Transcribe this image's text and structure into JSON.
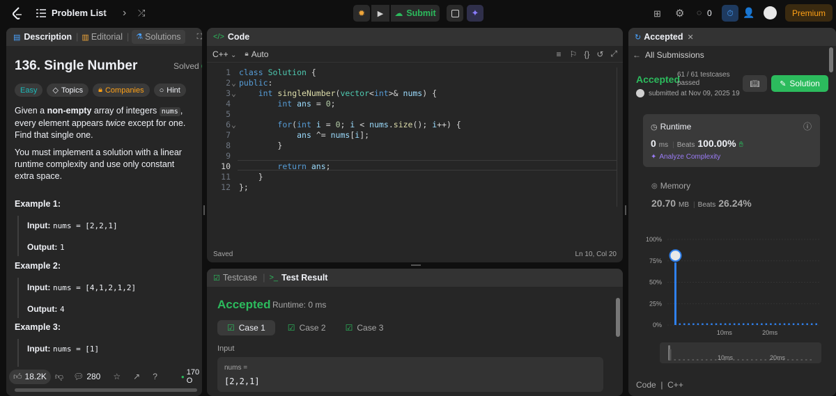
{
  "topbar": {
    "problem_list": "Problem List",
    "submit": "Submit",
    "streak": "0",
    "premium": "Premium"
  },
  "left": {
    "tabs": {
      "description": "Description",
      "editorial": "Editorial",
      "solutions": "Solutions"
    },
    "title": "136. Single Number",
    "solved": "Solved",
    "tags": {
      "easy": "Easy",
      "topics": "Topics",
      "companies": "Companies",
      "hint": "Hint"
    },
    "p1a": "Given a ",
    "p1b": "non-empty",
    "p1c": " array of integers ",
    "p1d": "nums",
    "p1e": ", every element appears ",
    "p1f": "twice",
    "p1g": " except for one. Find that single one.",
    "p2": "You must implement a solution with a linear runtime complexity and use only constant extra space.",
    "ex1": {
      "title": "Example 1:",
      "input_label": "Input:",
      "input": "nums = [2,2,1]",
      "output_label": "Output:",
      "output": "1"
    },
    "ex2": {
      "title": "Example 2:",
      "input_label": "Input:",
      "input": "nums = [4,1,2,1,2]",
      "output_label": "Output:",
      "output": "4"
    },
    "ex3": {
      "title": "Example 3:",
      "input_label": "Input:",
      "input": "nums = [1]"
    },
    "footer": {
      "likes": "18.2K",
      "comments": "280",
      "online": "170 O"
    }
  },
  "code": {
    "title": "Code",
    "lang": "C++",
    "auto": "Auto",
    "saved": "Saved",
    "cursor": "Ln 10, Col 20"
  },
  "test": {
    "testcase": "Testcase",
    "result": "Test Result",
    "accepted": "Accepted",
    "runtime": "Runtime: 0 ms",
    "cases": [
      "Case 1",
      "Case 2",
      "Case 3"
    ],
    "input_label": "Input",
    "var": "nums =",
    "value": "[2,2,1]"
  },
  "right": {
    "tab": "Accepted",
    "back": "All Submissions",
    "status": "Accepted",
    "passed1": "61 / 61 testcases",
    "passed2": "passed",
    "solution_btn": "Solution",
    "submitted": "submitted at Nov 09, 2025 19",
    "runtime_label": "Runtime",
    "runtime_val": "0",
    "runtime_unit": "ms",
    "beats_label": "Beats",
    "runtime_beats": "100.00%",
    "analyze": "Analyze Complexity",
    "memory_label": "Memory",
    "memory_val": "20.70",
    "memory_unit": "MB",
    "memory_beats": "26.24%",
    "bottom": "Code  |  C++"
  },
  "chart_data": {
    "type": "bar",
    "y_ticks": [
      "100%",
      "75%",
      "50%",
      "25%",
      "0%"
    ],
    "x_ticks": [
      "10ms",
      "20ms"
    ],
    "ylim": [
      0,
      100
    ],
    "values": [
      73,
      2,
      2,
      2,
      2,
      2,
      2,
      2,
      2,
      2,
      2,
      2,
      2,
      2,
      2,
      2,
      2,
      2,
      2,
      2,
      2,
      2,
      2,
      2,
      2,
      2,
      2,
      2,
      2,
      2,
      2,
      2
    ],
    "highlight_index": 0,
    "colors": {
      "bar": "#2f80ed",
      "highlight": "#2f80ed"
    }
  }
}
